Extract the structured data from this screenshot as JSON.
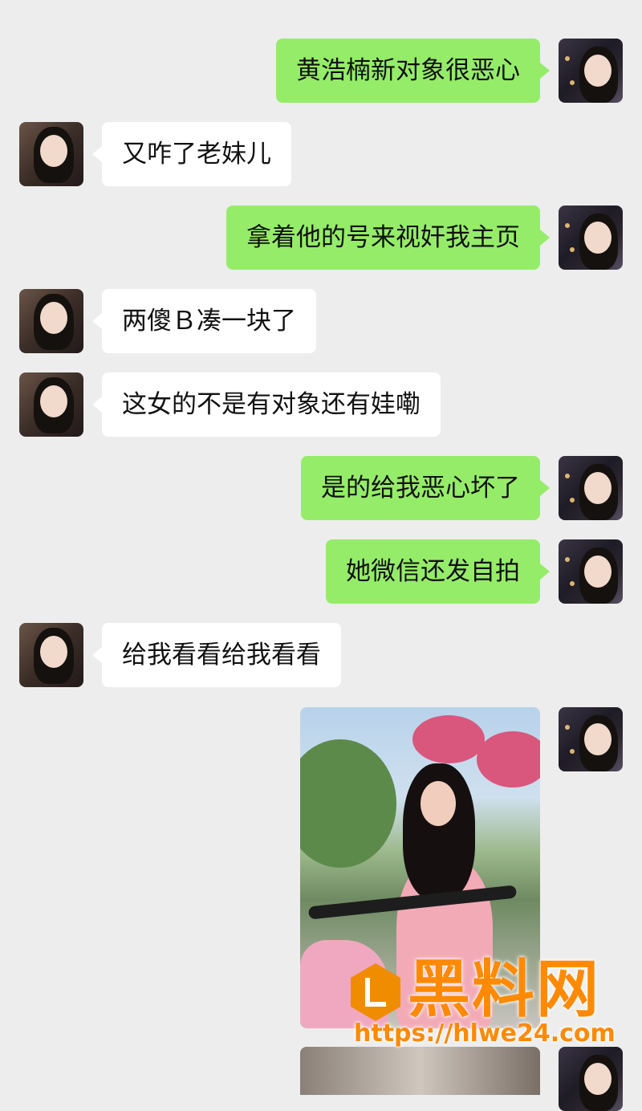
{
  "chat": {
    "messages": [
      {
        "sender": "me",
        "text": "黄浩楠新对象很恶心"
      },
      {
        "sender": "them",
        "text": "又咋了老妹儿"
      },
      {
        "sender": "me",
        "text": "拿着他的号来视奸我主页"
      },
      {
        "sender": "them",
        "text": "两傻Ｂ凑一块了"
      },
      {
        "sender": "them",
        "text": "这女的不是有对象还有娃嘞"
      },
      {
        "sender": "me",
        "text": "是的给我恶心坏了"
      },
      {
        "sender": "me",
        "text": "她微信还发自拍"
      },
      {
        "sender": "them",
        "text": "给我看看给我看看"
      }
    ],
    "image_message": {
      "sender": "me",
      "kind": "photo"
    }
  },
  "watermark": {
    "title": "黑料网",
    "url": "https://hlwe24.com",
    "color": "#ff8a00"
  },
  "colors": {
    "background": "#ededed",
    "my_bubble": "#95ec69",
    "their_bubble": "#ffffff"
  }
}
